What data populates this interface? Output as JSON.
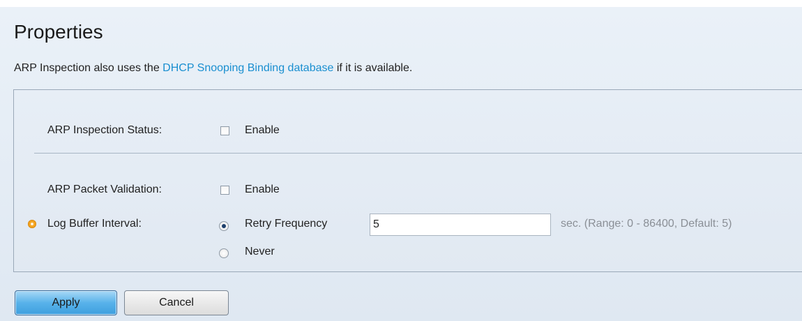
{
  "header": {
    "title": "Properties",
    "description_prefix": "ARP Inspection also uses the ",
    "description_link": "DHCP Snooping Binding database",
    "description_suffix": " if it is available."
  },
  "form": {
    "arp_inspection_status": {
      "label": "ARP Inspection Status:",
      "checkbox_label": "Enable",
      "checked": false
    },
    "arp_packet_validation": {
      "label": "ARP Packet Validation:",
      "checkbox_label": "Enable",
      "checked": false
    },
    "log_buffer_interval": {
      "label": "Log Buffer Interval:",
      "retry_option_label": "Retry Frequency",
      "retry_selected": true,
      "retry_value": "5",
      "hint": "sec. (Range: 0 - 86400, Default: 5)",
      "never_option_label": "Never",
      "never_selected": false
    }
  },
  "buttons": {
    "apply_label": "Apply",
    "cancel_label": "Cancel"
  },
  "colors": {
    "link": "#1a8fd0",
    "required_marker": "#f5a623",
    "apply_button": "#58b2ea"
  }
}
